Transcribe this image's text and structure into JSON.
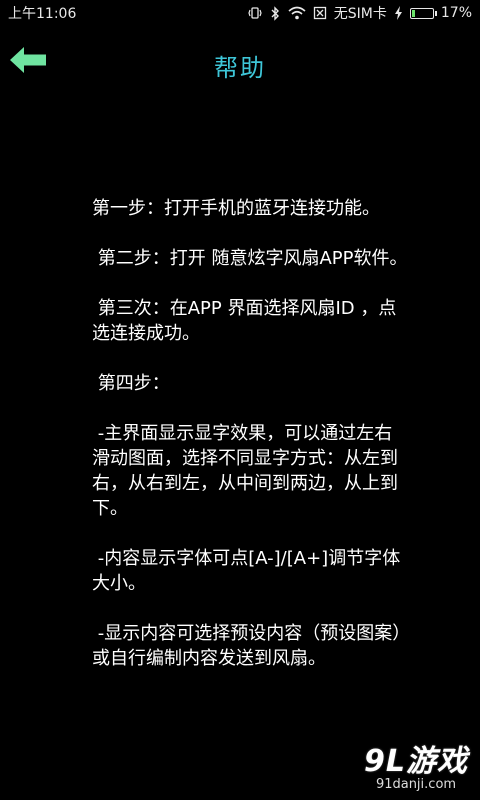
{
  "status_bar": {
    "time": "上午11:06",
    "carrier": "无SIM卡",
    "battery_percent": "17%",
    "battery_level": 0.17,
    "icons": [
      "vibrate-icon",
      "bluetooth-icon",
      "wifi-icon",
      "sim-card-icon",
      "charging-icon",
      "battery-icon"
    ]
  },
  "header": {
    "title": "帮助",
    "back_icon": "arrow-left-icon",
    "accent_color": "#3ec6d8",
    "back_color": "#6fe3a0"
  },
  "help": {
    "paragraphs": [
      "第一步：打开手机的蓝牙连接功能。",
      " 第二步：打开 随意炫字风扇APP软件。",
      " 第三次：在APP 界面选择风扇ID ，点选连接成功。",
      " 第四步：",
      " -主界面显示显字效果，可以通过左右滑动图面，选择不同显字方式：从左到右，从右到左，从中间到两边，从上到下。",
      " -内容显示字体可点[A-]/[A+]调节字体大小。",
      " -显示内容可选择预设内容（预设图案）或自行编制内容发送到风扇。"
    ]
  },
  "watermark": {
    "main": "9L游戏",
    "sub": "91danji.com"
  }
}
